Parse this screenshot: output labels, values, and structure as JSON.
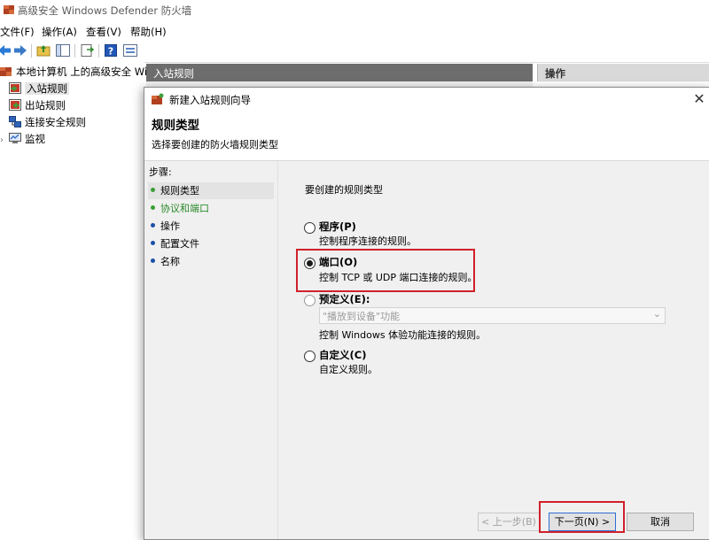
{
  "window": {
    "title": "高级安全 Windows Defender 防火墙"
  },
  "menu": [
    "文件(F)",
    "操作(A)",
    "查看(V)",
    "帮助(H)"
  ],
  "toolbar_icons": [
    "back-arrow-icon",
    "forward-arrow-icon",
    "up-folder-icon",
    "show-hide-tree-icon",
    "export-list-icon",
    "help-icon",
    "properties-icon"
  ],
  "tree": {
    "root": "本地计算机 上的高级安全 Windows",
    "items": [
      "入站规则",
      "出站规则",
      "连接安全规则",
      "监视"
    ]
  },
  "center": {
    "header": "入站规则"
  },
  "actions": {
    "header": "操作"
  },
  "wizard": {
    "title": "新建入站规则向导",
    "heading": "规则类型",
    "subheading": "选择要创建的防火墙规则类型",
    "steps_header": "步骤:",
    "steps": [
      "规则类型",
      "协议和端口",
      "操作",
      "配置文件",
      "名称"
    ],
    "question": "要创建的规则类型",
    "options": [
      {
        "label": "程序(P)",
        "desc": "控制程序连接的规则。",
        "selected": false
      },
      {
        "label": "端口(O)",
        "desc": "控制 TCP 或 UDP 端口连接的规则。",
        "selected": true
      },
      {
        "label": "预定义(E):",
        "desc": "控制 Windows 体验功能连接的规则。",
        "selected": false
      },
      {
        "label": "自定义(C)",
        "desc": "自定义规则。",
        "selected": false
      }
    ],
    "predefined_value": "\"播放到设备\"功能",
    "buttons": {
      "back": "< 上一步(B)",
      "next": "下一页(N) >",
      "cancel": "取消"
    }
  },
  "colors": {
    "highlight_box": "#d0202a",
    "step_dot_green": "#3aa035",
    "step_dot_blue": "#1c4fa8",
    "header_bg": "#6d6d6d"
  }
}
